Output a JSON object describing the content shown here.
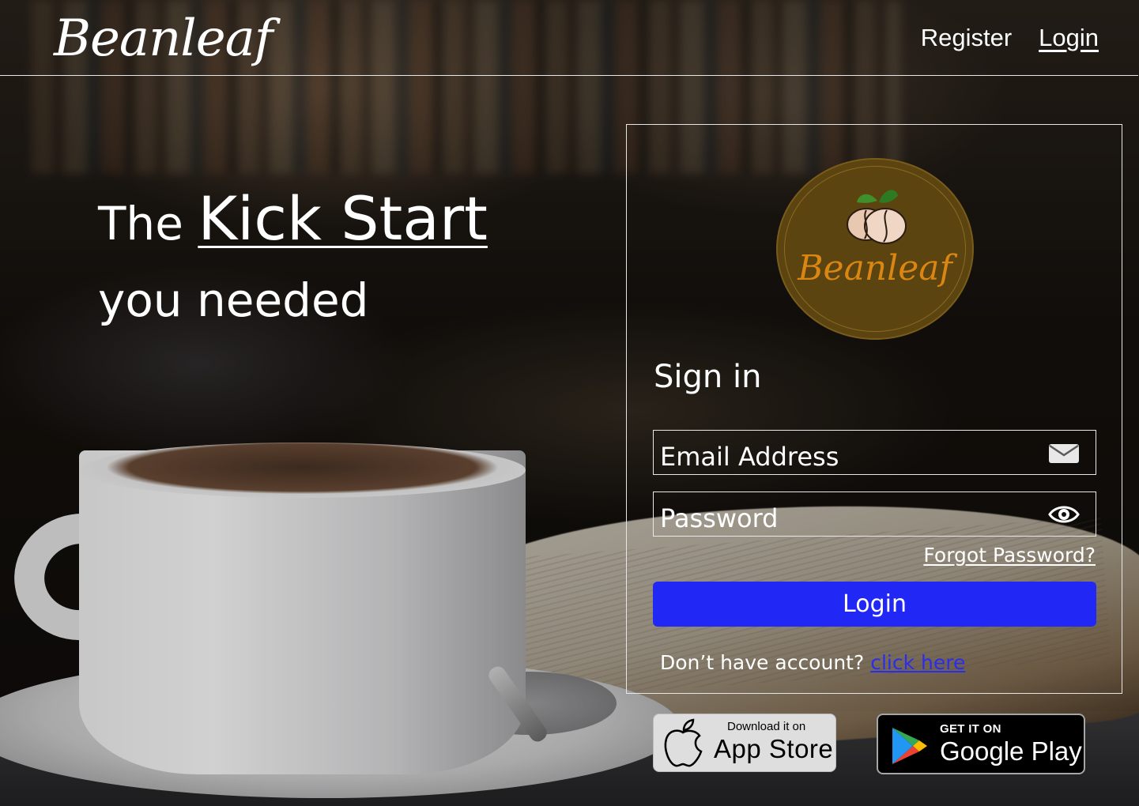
{
  "header": {
    "brand": "Beanleaf",
    "nav": [
      {
        "label": "Register"
      },
      {
        "label": "Login"
      }
    ]
  },
  "hero": {
    "prefix": "The",
    "highlight": "Kick Start",
    "line2": "you needed"
  },
  "signin": {
    "logo_text": "Beanleaf",
    "title": "Sign in",
    "email_placeholder": "Email Address",
    "password_placeholder": "Password",
    "forgot_label": "Forgot Password?",
    "login_label": "Login",
    "no_account_text": "Don’t have account?",
    "click_here_label": "click here",
    "accent_color": "#2128f5"
  },
  "stores": {
    "appstore": {
      "small": "Download it on",
      "big": "App Store"
    },
    "googleplay": {
      "small": "GET IT ON",
      "big": "Google Play"
    }
  },
  "icons": [
    "mail-icon",
    "eye-icon",
    "apple-icon",
    "google-play-icon",
    "coffee-bean-leaf-icon"
  ]
}
